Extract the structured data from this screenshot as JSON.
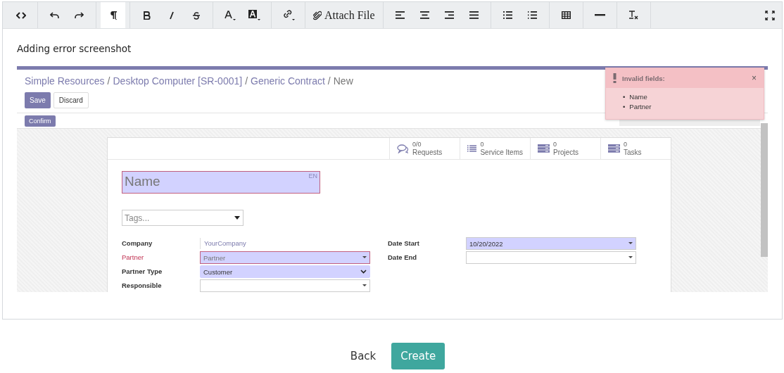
{
  "toolbar": [
    {
      "items": [
        {
          "kind": "code",
          "selected": false
        }
      ]
    },
    {
      "items": [
        {
          "kind": "undo",
          "selected": false
        },
        {
          "kind": "redo",
          "selected": false
        }
      ]
    },
    {
      "items": [
        {
          "kind": "paragraph",
          "selected": true
        }
      ]
    },
    {
      "items": [
        {
          "kind": "bold",
          "selected": false
        },
        {
          "kind": "italic",
          "selected": false
        },
        {
          "kind": "strike",
          "selected": false
        }
      ]
    },
    {
      "items": [
        {
          "kind": "font-color",
          "selected": false
        },
        {
          "kind": "highlight",
          "selected": false
        }
      ]
    },
    {
      "items": [
        {
          "kind": "link",
          "selected": false
        }
      ]
    },
    {
      "items": [
        {
          "kind": "attach",
          "label": "Attach File",
          "selected": false
        }
      ]
    },
    {
      "items": [
        {
          "kind": "align-left",
          "selected": false
        },
        {
          "kind": "align-center",
          "selected": false
        },
        {
          "kind": "align-right",
          "selected": false
        },
        {
          "kind": "justify",
          "selected": false
        }
      ]
    },
    {
      "items": [
        {
          "kind": "bullets",
          "selected": false
        },
        {
          "kind": "numbers",
          "selected": false
        }
      ]
    },
    {
      "items": [
        {
          "kind": "table",
          "selected": false
        }
      ]
    },
    {
      "items": [
        {
          "kind": "rule",
          "selected": false
        }
      ]
    },
    {
      "items": [
        {
          "kind": "clear-format",
          "selected": false
        }
      ]
    }
  ],
  "body_text": "Adding error screenshot",
  "shot": {
    "breadcrumb": [
      {
        "label": "Simple Resources"
      },
      {
        "label": "Desktop Computer [SR-0001]"
      },
      {
        "label": "Generic Contract"
      },
      {
        "label": "New"
      }
    ],
    "separator": "/",
    "buttons": [
      {
        "label": "Save",
        "kind": "primary"
      },
      {
        "label": "Discard",
        "kind": "secondary"
      }
    ],
    "confirm": "Confirm",
    "stats": [
      {
        "kind": "chat",
        "value": "0/0",
        "label": "Requests"
      },
      {
        "kind": "list",
        "value": "0",
        "label": "Service Items"
      },
      {
        "kind": "stack",
        "value": "0",
        "label": "Projects"
      },
      {
        "kind": "stack",
        "value": "0",
        "label": "Tasks"
      }
    ],
    "name": {
      "placeholder": "Name",
      "lang": "EN",
      "invalid": true
    },
    "tags": {
      "placeholder": "Tags..."
    },
    "left_fields": [
      {
        "label": "Company",
        "kind": "text",
        "value": "YourCompany",
        "invalid": false
      },
      {
        "label": "Partner",
        "kind": "select",
        "placeholder": "Partner",
        "invalid": true,
        "required": true
      },
      {
        "label": "Partner Type",
        "kind": "combo",
        "value": "Customer",
        "invalid": false,
        "required": true
      },
      {
        "label": "Responsible",
        "kind": "select",
        "invalid": false,
        "required": false
      }
    ],
    "right_fields": [
      {
        "label": "Date Start",
        "kind": "select",
        "value": "10/20/2022",
        "invalid": false,
        "required": true
      },
      {
        "label": "Date End",
        "kind": "select",
        "invalid": false,
        "required": false
      }
    ],
    "toast": {
      "title": "Invalid fields:",
      "close": "×",
      "marker": "•",
      "items": [
        "Name",
        "Partner"
      ]
    }
  },
  "actions": [
    {
      "label": "Back",
      "kind": "link"
    },
    {
      "label": "Create",
      "kind": "primary"
    }
  ]
}
